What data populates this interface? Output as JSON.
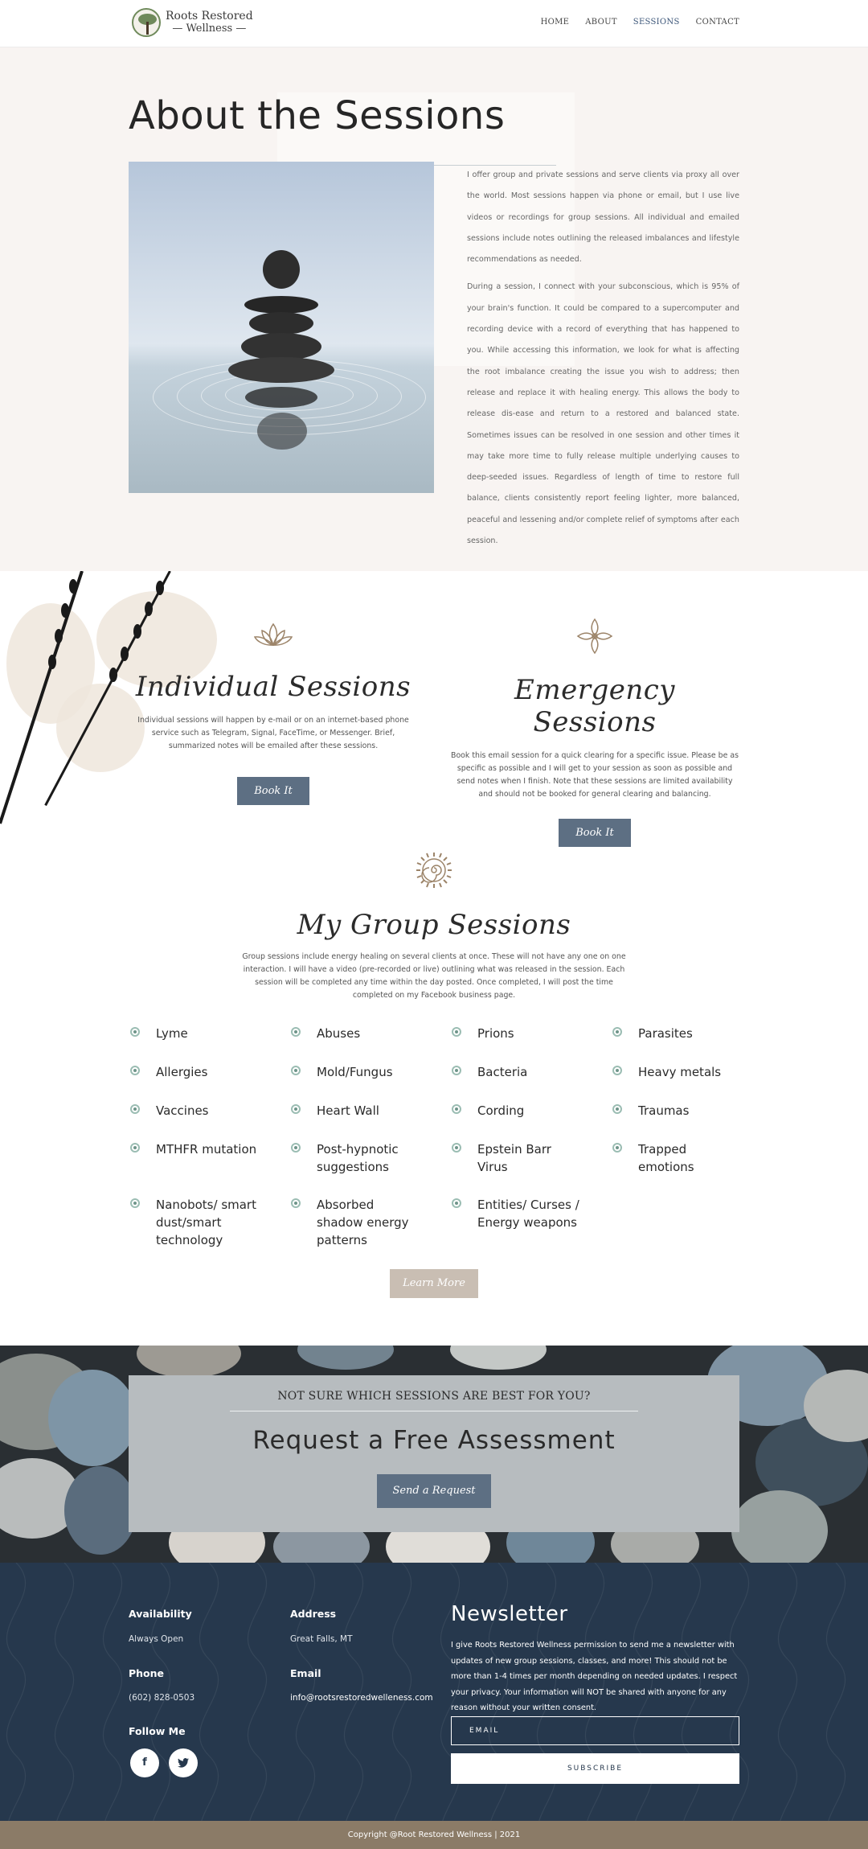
{
  "header": {
    "brand_line1": "Roots Restored",
    "brand_line2": "— Wellness —",
    "nav": [
      "HOME",
      "ABOUT",
      "SESSIONS",
      "CONTACT"
    ]
  },
  "about": {
    "title": "About the Sessions",
    "paragraph1": "I offer group and private sessions and serve clients via proxy all over the world. Most sessions happen via phone or email, but I use live videos or recordings for group sessions. All individual and emailed sessions include notes outlining the released imbalances and lifestyle recommendations as needed.",
    "paragraph2": "During a session, I connect with your subconscious, which is 95% of your brain's function. It could be compared to a supercomputer and recording device with a record of everything that has happened to you. While accessing this information, we look for what is affecting the root imbalance creating the issue you wish to address; then release and replace it with healing energy. This allows the body to release dis-ease and return to a restored and balanced state. Sometimes issues can be resolved in one session and other times it may take more time to fully release multiple underlying causes to deep-seeded issues. Regardless of length of time to restore full balance, clients consistently report feeling lighter, more balanced, peaceful and lessening and/or complete relief of symptoms after each session."
  },
  "individual": {
    "title": "Individual Sessions",
    "description": "Individual sessions will happen by e-mail or on an internet-based phone service such as Telegram, Signal, FaceTime, or Messenger. Brief, summarized notes will be emailed after these sessions.",
    "button": "Book It"
  },
  "emergency": {
    "title": "Emergency Sessions",
    "description": "Book this email session for a quick clearing for a specific issue. Please be as specific as possible and I will get to your session as soon as possible and send notes when I finish. Note that these sessions are limited availability and should not be booked for general clearing and balancing.",
    "button": "Book It"
  },
  "group": {
    "title": "My Group Sessions",
    "description": "Group sessions include energy healing on several clients at once. These will not have any one on one interaction. I will have a video (pre-recorded or live) outlining what was released in the session. Each session will be completed any time within the day posted. Once completed, I will post the time completed on my Facebook business page.",
    "topics": [
      "Lyme",
      "Abuses",
      "Prions",
      "Parasites",
      "Allergies",
      "Mold/Fungus",
      "Bacteria",
      "Heavy metals",
      "Vaccines",
      "Heart Wall",
      "Cording",
      "Traumas",
      "MTHFR mutation",
      "Post-hypnotic suggestions",
      "Epstein Barr Virus",
      "Trapped emotions",
      "Nanobots/ smart dust/smart technology",
      "Absorbed shadow energy patterns",
      "Entities/ Curses / Energy weapons"
    ],
    "button": "Learn More"
  },
  "assessment": {
    "eyebrow": "NOT SURE WHICH SESSIONS ARE BEST FOR YOU?",
    "title": "Request a Free Assessment",
    "button": "Send a Request"
  },
  "footer": {
    "availability_label": "Availability",
    "availability_value": "Always Open",
    "address_label": "Address",
    "address_value": "Great Falls, MT",
    "phone_label": "Phone",
    "phone_value": "(602) 828-0503",
    "email_label": "Email",
    "email_value": "info@rootsrestoredwelleness.com",
    "follow_label": "Follow Me",
    "newsletter_title": "Newsletter",
    "newsletter_text": "I give Roots Restored Wellness permission to send me a newsletter with updates of new group sessions, classes, and more! This should not be more than 1-4 times per month depending on needed updates. I respect your privacy. Your information will NOT be shared with anyone for any reason without your written consent.",
    "email_placeholder": "EMAIL",
    "subscribe": "SUBSCRIBE",
    "copyright": "Copyright @Root Restored Wellness | 2021"
  },
  "colors": {
    "accent": "#5d6f83",
    "footer_bg": "#26384d",
    "about_bg": "#f8f4f2",
    "copyright_bg": "#8b7b67",
    "bullet": "#9bbdb3"
  },
  "icons": [
    "lotus-icon",
    "flower-icon",
    "spiral-sun-icon",
    "facebook-icon",
    "twitter-icon",
    "bullet-icon"
  ]
}
